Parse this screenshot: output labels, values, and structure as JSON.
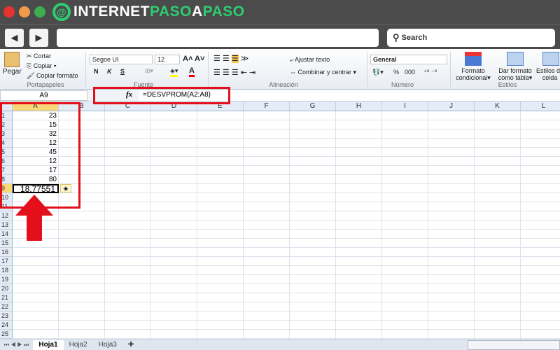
{
  "browser": {
    "logo_text_white1": "INTERNET",
    "logo_text_green1": "PASO",
    "logo_text_white2": "A",
    "logo_text_green2": "PASO",
    "search_label": "Search",
    "back": "◀",
    "forward": "▶"
  },
  "ribbon": {
    "clipboard": {
      "paste": "Pegar",
      "cut": "Cortar",
      "copy": "Copiar",
      "format_painter": "Copiar formato",
      "group": "Portapapeles"
    },
    "font": {
      "name": "Segoe UI",
      "size": "12",
      "bold": "N",
      "italic": "K",
      "underline": "S",
      "group": "Fuente"
    },
    "alignment": {
      "wrap": "Ajustar texto",
      "merge": "Combinar y centrar",
      "group": "Alineación"
    },
    "number": {
      "format": "General",
      "percent": "%",
      "thousands": "000",
      "group": "Número"
    },
    "styles": {
      "conditional": [
        "Formato",
        "condicional"
      ],
      "table": [
        "Dar formato",
        "como tabla"
      ],
      "cell": [
        "Estilos de",
        "celda"
      ],
      "group": "Estilos"
    }
  },
  "formula_bar": {
    "name_box": "A9",
    "fx": "fx",
    "formula": "=DESVPROM(A2:A8)"
  },
  "columns": [
    "A",
    "B",
    "C",
    "D",
    "E",
    "F",
    "G",
    "H",
    "I",
    "J",
    "K",
    "L"
  ],
  "rows": [
    "1",
    "2",
    "3",
    "4",
    "5",
    "6",
    "7",
    "8",
    "9",
    "10",
    "11",
    "12",
    "13",
    "14",
    "15",
    "16",
    "17",
    "18",
    "19",
    "20",
    "21",
    "22",
    "23",
    "24",
    "25"
  ],
  "cells_A": [
    "23",
    "15",
    "32",
    "12",
    "45",
    "12",
    "17",
    "80",
    "18,77551"
  ],
  "sheets": [
    "Hoja1",
    "Hoja2",
    "Hoja3"
  ],
  "colors": {
    "highlight": "#e3101c",
    "accent": "#2ecc71"
  }
}
